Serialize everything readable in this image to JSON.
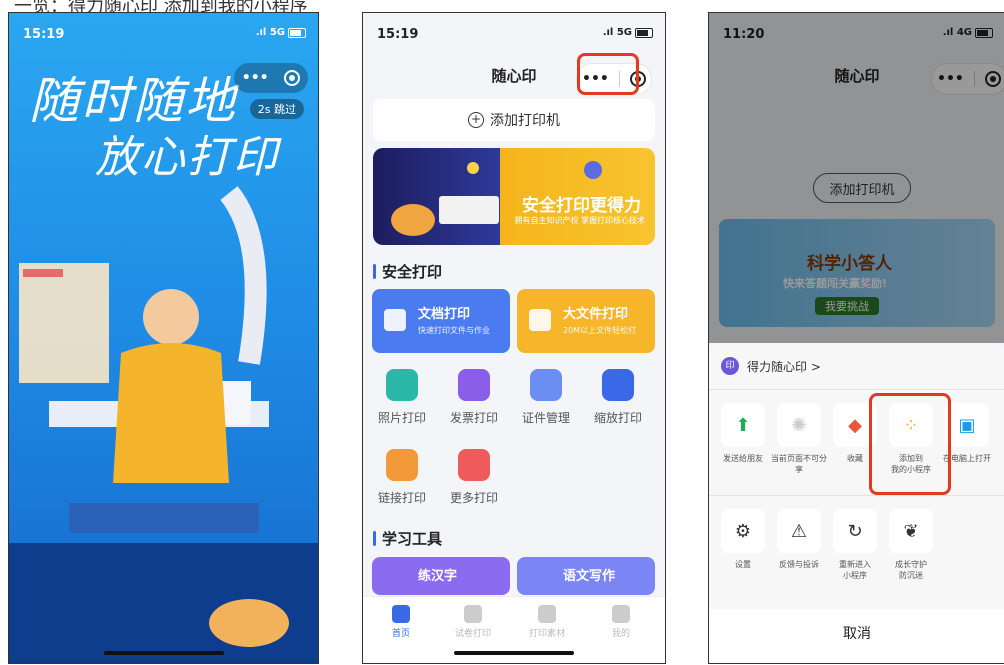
{
  "caption": "一览：得力随心印  添加到我的小程序",
  "phones": [
    {
      "status_time": "15:19",
      "status_signal": ".ıl 5G",
      "splash_title_line1": "随时随地",
      "splash_title_line2": "放心打印",
      "skip_label": "2s 跳过"
    },
    {
      "status_time": "15:19",
      "status_signal": ".ıl 5G",
      "nav_title": "随心印",
      "add_printer_label": "添加打印机",
      "banner_title": "安全打印更得力",
      "banner_subtitle": "拥有自主知识产权 掌握打印核心技术",
      "section_secure": "安全打印",
      "doc_print_title": "文档打印",
      "doc_print_sub": "快速打印文件与作业",
      "bigfile_title": "大文件打印",
      "bigfile_sub": "20M以上文件轻松打",
      "grid": [
        "照片打印",
        "发票打印",
        "证件管理",
        "缩放打印",
        "链接打印",
        "更多打印"
      ],
      "section_study": "学习工具",
      "study_card1": "练汉字",
      "study_card2": "语文写作",
      "tabs": [
        "首页",
        "试卷打印",
        "打印素材",
        "我的"
      ]
    },
    {
      "status_time": "11:20",
      "status_signal": ".ıl 4G",
      "nav_title": "随心印",
      "add_printer_label": "添加打印机",
      "banner_title": "科学小答人",
      "banner_sub": "快来答题闯关赢奖励!",
      "banner_button": "我要挑战",
      "app_logo": "印",
      "app_name": "得力随心印 >",
      "actions_row1": [
        "发送给朋友",
        "当前页面不可分享",
        "收藏",
        "添加到\n我的小程序",
        "在电脑上打开"
      ],
      "actions_row2": [
        "设置",
        "反馈与投诉",
        "重新进入\n小程序",
        "成长守护\n防沉迷"
      ],
      "cancel_label": "取消"
    }
  ]
}
